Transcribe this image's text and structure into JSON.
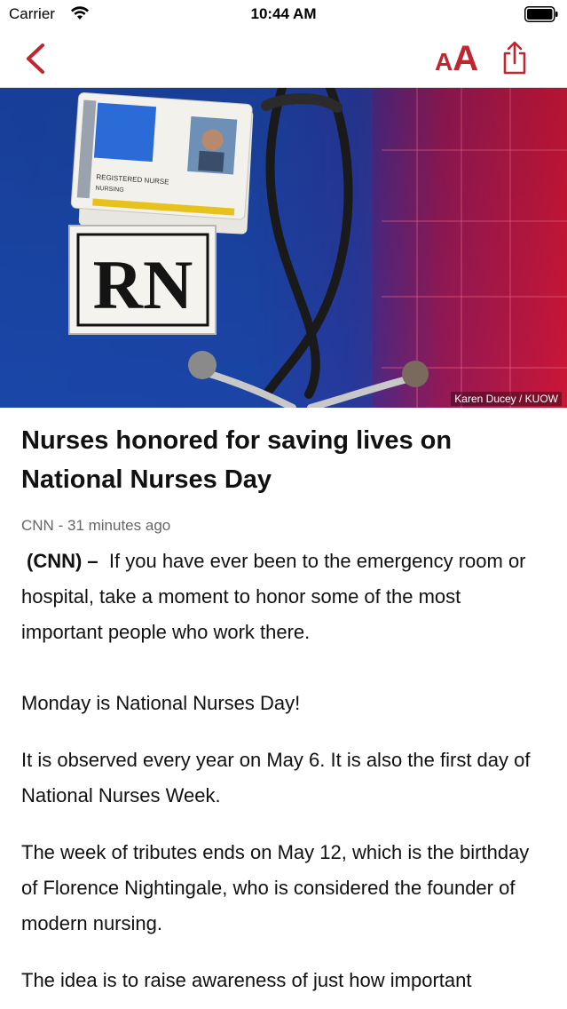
{
  "status_bar": {
    "carrier": "Carrier",
    "time": "10:44 AM"
  },
  "nav": {
    "font_size_small": "A",
    "font_size_large": "A",
    "accent_color": "#c0262f"
  },
  "hero": {
    "badge_line1": "REGISTERED NURSE",
    "badge_line2": "NURSING",
    "rn_text": "RN",
    "credit": "Karen Ducey / KUOW"
  },
  "article": {
    "title": "Nurses honored for saving lives on National Nurses Day",
    "source": "CNN",
    "separator": "-",
    "time_ago": "31 minutes ago",
    "lead_label": "(CNN) –",
    "lead_text": "If you have ever been to the emergency room or hospital, take a moment to honor some of the most important people who work there.",
    "paragraphs": [
      "Monday is National Nurses Day!",
      "It is observed every year on May 6. It is also the first day of National Nurses Week.",
      "The week of tributes ends on May 12, which is the birthday of Florence Nightingale, who is considered the founder of modern nursing.",
      "The idea is to raise awareness of just how important"
    ]
  }
}
